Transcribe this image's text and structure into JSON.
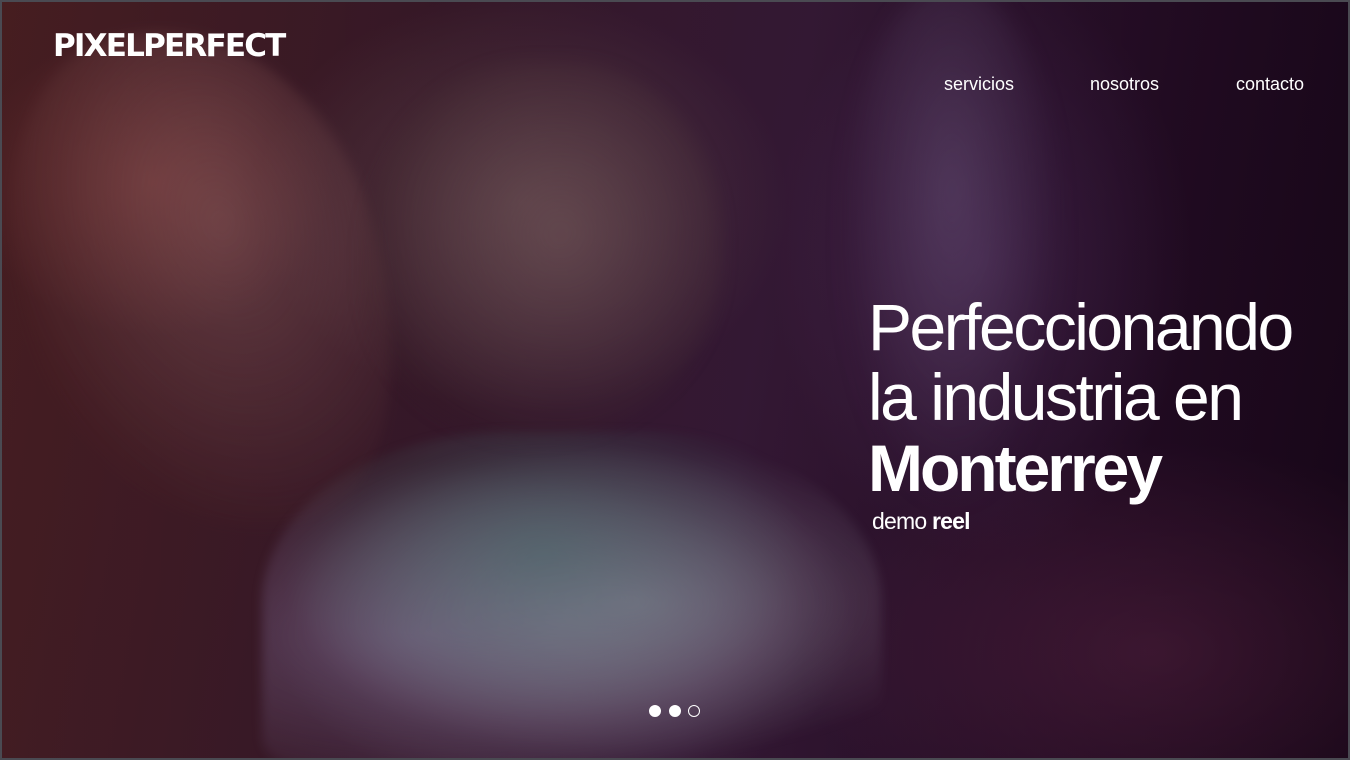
{
  "brand": {
    "logo_text": "PIXELPERFECT"
  },
  "nav": {
    "items": [
      {
        "label": "servicios"
      },
      {
        "label": "nosotros"
      },
      {
        "label": "contacto"
      }
    ]
  },
  "hero": {
    "line1": "Perfeccionando",
    "line2": "la industria en",
    "line3": "Monterrey",
    "cta_light": "demo",
    "cta_bold": "reel"
  },
  "carousel": {
    "slide_count": 3,
    "active_states": [
      "filled",
      "filled",
      "outline"
    ]
  },
  "colors": {
    "text": "#ffffff",
    "background_dark": "#1e0a1e",
    "background_warm": "#4a1f22",
    "frame_border": "#4a4a52"
  }
}
